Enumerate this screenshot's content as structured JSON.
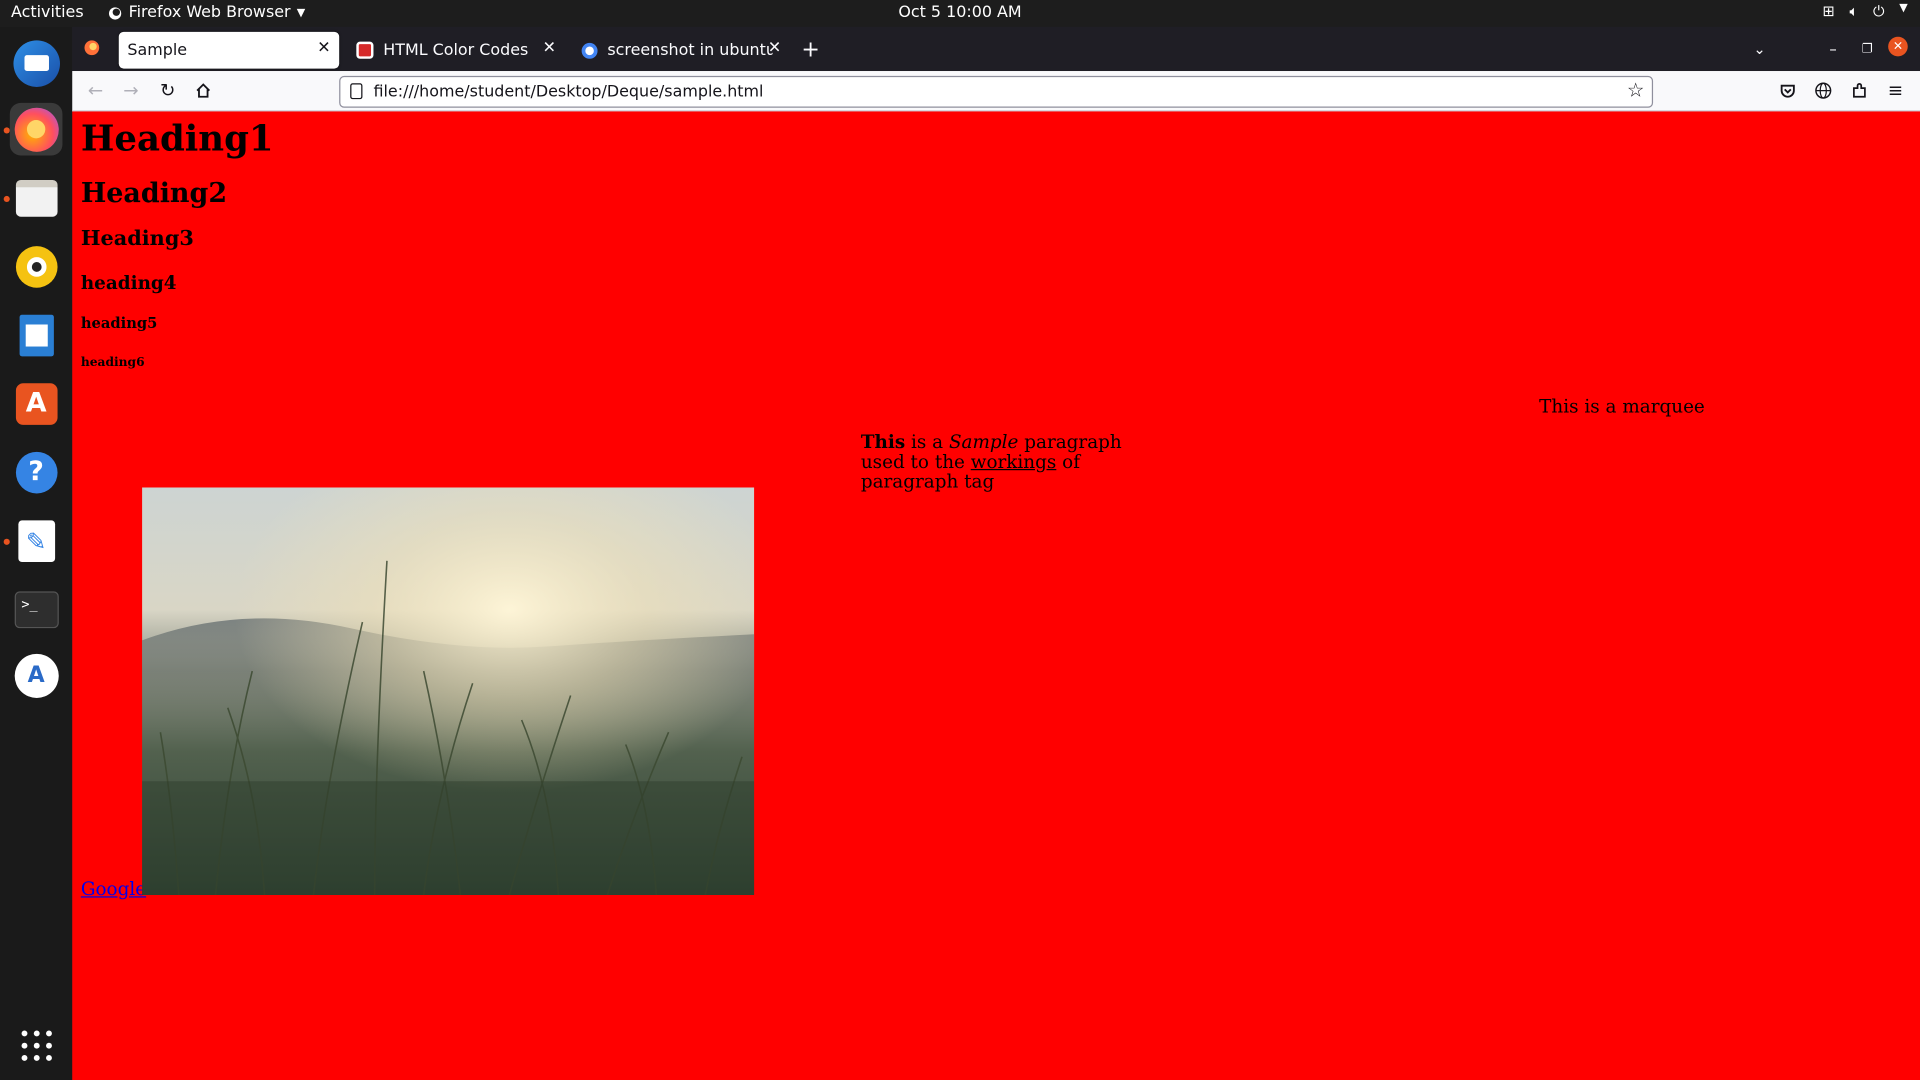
{
  "system_bar": {
    "activities": "Activities",
    "app_name": "Firefox Web Browser",
    "clock": "Oct 5  10:00 AM"
  },
  "dock": {
    "items": [
      "thunderbird-icon",
      "firefox-icon",
      "files-icon",
      "rhythmbox-icon",
      "writer-icon",
      "software-icon",
      "help-icon",
      "text-editor-icon",
      "terminal-icon",
      "android-studio-icon",
      "app-grid-icon"
    ]
  },
  "tabs": [
    {
      "label": "Sample",
      "active": true
    },
    {
      "label": "HTML Color Codes",
      "active": false
    },
    {
      "label": "screenshot in ubuntu - Go",
      "active": false
    }
  ],
  "address_bar": {
    "url": "file:///home/student/Desktop/Deque/sample.html"
  },
  "page": {
    "background": "#ff0000",
    "h1": "Heading1",
    "h2": "Heading2",
    "h3": "Heading3",
    "h4": "heading4",
    "h5": "heading5",
    "h6": "heading6",
    "marquee": "This is a marquee",
    "para": {
      "bold": "This",
      "t1": " is a ",
      "italic": "Sample",
      "t2": " paragraph used to the ",
      "underline": "workings",
      "t3": " of paragraph tag"
    },
    "link": "Google"
  },
  "colors": {
    "accent": "#e95420",
    "link": "#0000ee"
  }
}
